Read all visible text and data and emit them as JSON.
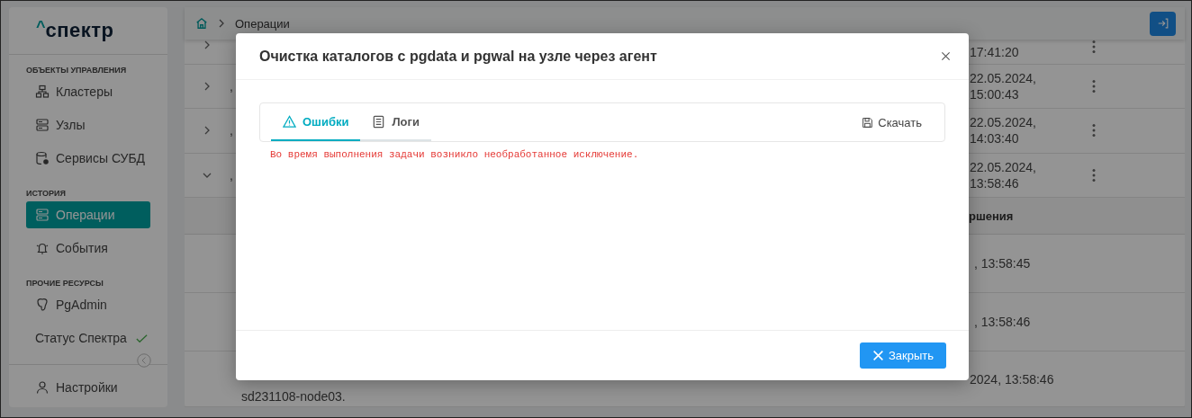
{
  "sidebar": {
    "logo_mark": "^",
    "logo": "спектр",
    "sections": [
      {
        "title": "ОБЪЕКТЫ УПРАВЛЕНИЯ",
        "items": [
          {
            "label": "Кластеры",
            "selected": false
          },
          {
            "label": "Узлы",
            "selected": false
          },
          {
            "label": "Сервисы СУБД",
            "selected": false
          }
        ]
      },
      {
        "title": "ИСТОРИЯ",
        "items": [
          {
            "label": "Операции",
            "selected": true
          },
          {
            "label": "События",
            "selected": false
          }
        ]
      },
      {
        "title": "ПРОЧИЕ РЕСУРСЫ",
        "items": [
          {
            "label": "PgAdmin",
            "selected": false
          },
          {
            "label": "Статус Спектра",
            "selected": false,
            "ok": true
          }
        ]
      }
    ],
    "footer_item": {
      "label": "Настройки"
    }
  },
  "breadcrumb": {
    "current": "Операции"
  },
  "table": {
    "rows": [
      {
        "expanded": false,
        "time": "17:41:20"
      },
      {
        "expanded": false,
        "column_2": ",",
        "date": "22.05.2024,",
        "time": "15:00:43"
      },
      {
        "expanded": false,
        "column_2": ",",
        "date": "22.05.2024,",
        "time": "14:03:40"
      },
      {
        "expanded": true,
        "column_2": ",",
        "date": "22.05.2024,",
        "time": "13:58:46"
      }
    ]
  },
  "nested": {
    "header": "ршения",
    "rows": [
      {
        "finished": ", 13:58:45"
      },
      {
        "finished": ", 13:58:46"
      },
      {
        "description": "sd231108-node03.",
        "finished": "2024, 13:58:46"
      }
    ]
  },
  "dialog": {
    "title": "Очистка каталогов с pgdata и pgwal на узле через агент",
    "tabs": [
      {
        "label": "Ошибки",
        "selected": true
      },
      {
        "label": "Логи",
        "selected": false
      }
    ],
    "download": "Скачать",
    "error": "Во время выполнения задачи возникло необработанное исключение.",
    "close_button": "Закрыть"
  }
}
